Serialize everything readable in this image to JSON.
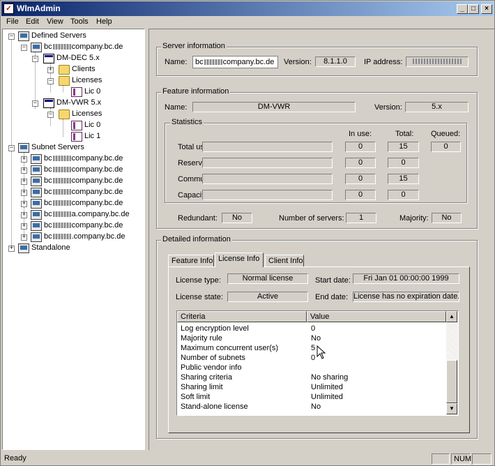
{
  "window": {
    "title": "WlmAdmin",
    "minimize": "_",
    "maximize": "□",
    "close": "×"
  },
  "menu": [
    "File",
    "Edit",
    "View",
    "Tools",
    "Help"
  ],
  "tree": {
    "defined_servers": "Defined Servers",
    "server1_prefix": "bc",
    "server1_suffix": "company.bc.de",
    "dm_dec": "DM-DEC 5.x",
    "clients": "Clients",
    "licenses1": "Licenses",
    "lic0_a": "Lic 0",
    "dm_vwr": "DM-VWR 5.x",
    "licenses2": "Licenses",
    "lic0_b": "Lic 0",
    "lic1": "Lic 1",
    "subnet_servers": "Subnet Servers",
    "subnet_items": [
      {
        "prefix": "bc",
        "suffix": "company.bc.de"
      },
      {
        "prefix": "bc",
        "suffix": "company.bc.de"
      },
      {
        "prefix": "bc",
        "suffix": "company.bc.de"
      },
      {
        "prefix": "bc",
        "suffix": "company.bc.de"
      },
      {
        "prefix": "bc",
        "suffix": "company.bc.de"
      },
      {
        "prefix": "bc",
        "suffix": "a.company.bc.de"
      },
      {
        "prefix": "bc",
        "suffix": "company.bc.de"
      },
      {
        "prefix": "bc",
        "suffix": ".company.bc.de"
      }
    ],
    "standalone": "Standalone"
  },
  "server_info": {
    "title": "Server information",
    "name_label": "Name:",
    "name_prefix": "bc",
    "name_suffix": "company.bc.de",
    "version_label": "Version:",
    "version": "8.1.1.0",
    "ip_label": "IP address:"
  },
  "feature_info": {
    "title": "Feature information",
    "name_label": "Name:",
    "name": "DM-VWR",
    "version_label": "Version:",
    "version": "5.x"
  },
  "statistics": {
    "title": "Statistics",
    "col_inuse": "In use:",
    "col_total": "Total:",
    "col_queued": "Queued:",
    "rows": [
      {
        "label": "Total users:",
        "inuse": "0",
        "total": "15",
        "queued": "0"
      },
      {
        "label": "Reserved:",
        "inuse": "0",
        "total": "0"
      },
      {
        "label": "Commuter:",
        "inuse": "0",
        "total": "15"
      },
      {
        "label": "Capacity:",
        "inuse": "0",
        "total": "0"
      }
    ]
  },
  "redundancy": {
    "redundant_label": "Redundant:",
    "redundant": "No",
    "num_servers_label": "Number of servers:",
    "num_servers": "1",
    "majority_label": "Majority:",
    "majority": "No"
  },
  "detailed": {
    "title": "Detailed information",
    "tabs": [
      "Feature Info",
      "License Info",
      "Client Info"
    ],
    "license_type_label": "License type:",
    "license_type": "Normal license",
    "start_date_label": "Start date:",
    "start_date": "Fri Jan 01 00:00:00 1999",
    "license_state_label": "License state:",
    "license_state": "Active",
    "end_date_label": "End date:",
    "end_date": "License has no expiration date.",
    "col_criteria": "Criteria",
    "col_value": "Value",
    "rows": [
      {
        "criteria": "Log encryption level",
        "value": "0"
      },
      {
        "criteria": "Majority rule",
        "value": "No"
      },
      {
        "criteria": "Maximum concurrent user(s)",
        "value": "5"
      },
      {
        "criteria": "Number of subnets",
        "value": "0"
      },
      {
        "criteria": "Public vendor info",
        "value": ""
      },
      {
        "criteria": "Sharing criteria",
        "value": "No sharing"
      },
      {
        "criteria": "Sharing limit",
        "value": "Unlimited"
      },
      {
        "criteria": "Soft limit",
        "value": "Unlimited"
      },
      {
        "criteria": "Stand-alone license",
        "value": "No"
      }
    ]
  },
  "status": {
    "text": "Ready",
    "num": "NUM"
  }
}
